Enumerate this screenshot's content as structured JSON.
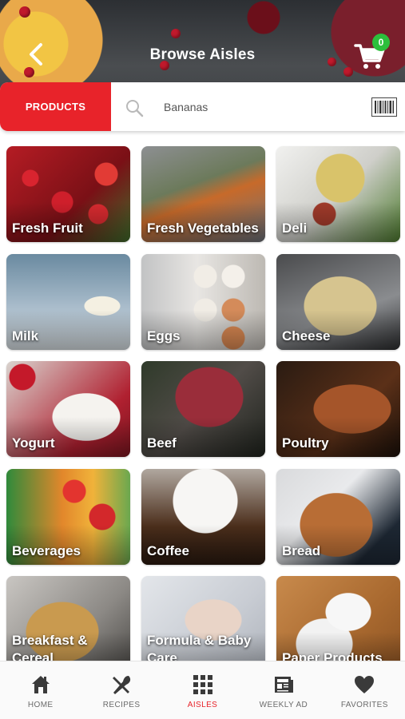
{
  "header": {
    "title": "Browse Aisles",
    "cart_count": "0"
  },
  "search": {
    "category_button": "PRODUCTS",
    "placeholder": "Bananas"
  },
  "aisles": [
    {
      "label": "Fresh Fruit"
    },
    {
      "label": "Fresh Vegetables"
    },
    {
      "label": "Deli"
    },
    {
      "label": "Milk"
    },
    {
      "label": "Eggs"
    },
    {
      "label": "Cheese"
    },
    {
      "label": "Yogurt"
    },
    {
      "label": "Beef"
    },
    {
      "label": "Poultry"
    },
    {
      "label": "Beverages"
    },
    {
      "label": "Coffee"
    },
    {
      "label": "Bread"
    },
    {
      "label": "Breakfast & Cereal"
    },
    {
      "label": "Formula & Baby Care"
    },
    {
      "label": "Paper Products"
    }
  ],
  "bottom_nav": [
    {
      "label": "HOME",
      "icon": "home-icon"
    },
    {
      "label": "RECIPES",
      "icon": "fork-knife-icon"
    },
    {
      "label": "AISLES",
      "icon": "grid-icon",
      "active": true
    },
    {
      "label": "WEEKLY AD",
      "icon": "newspaper-icon"
    },
    {
      "label": "FAVORITES",
      "icon": "heart-icon"
    }
  ],
  "colors": {
    "accent": "#e8232a",
    "cart_badge": "#2dbf3c",
    "nav_inactive": "#6b6b6b"
  }
}
